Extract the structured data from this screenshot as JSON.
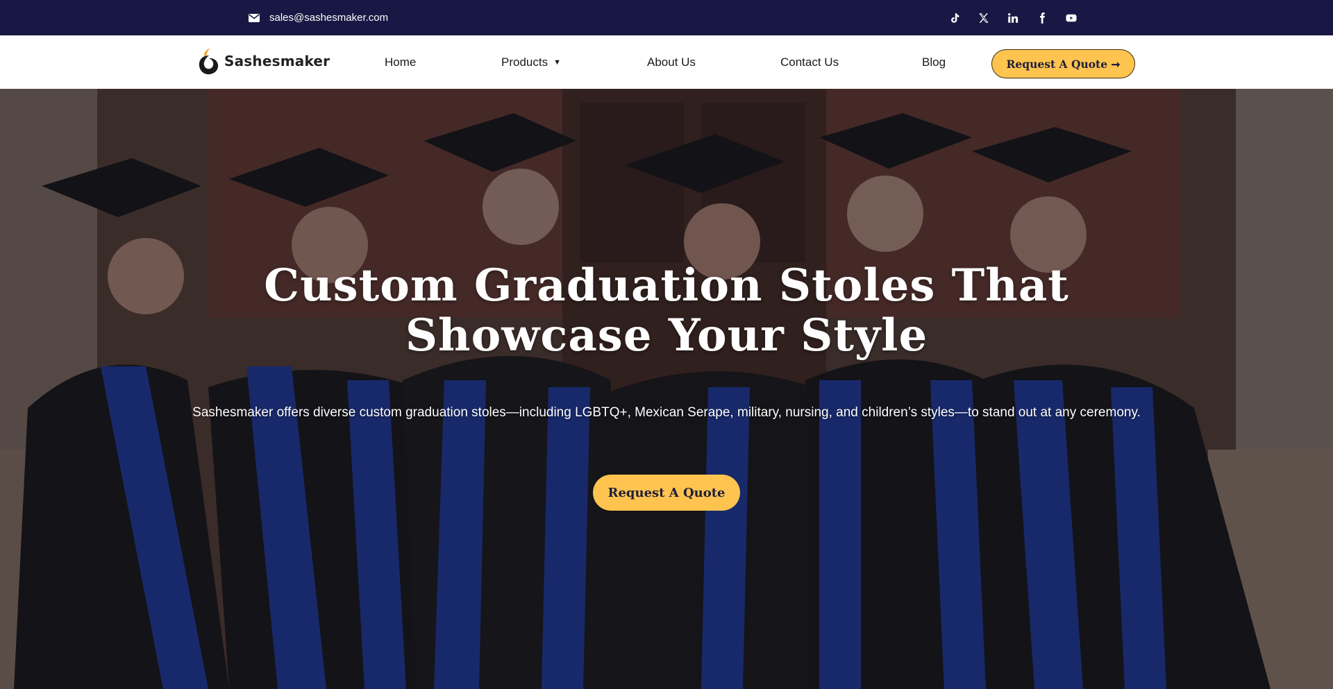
{
  "topbar": {
    "email": "sales@sashesmaker.com",
    "background": "#191844",
    "socials": [
      {
        "icon": "tiktok-icon"
      },
      {
        "icon": "x-icon"
      },
      {
        "icon": "linkedin-icon"
      },
      {
        "icon": "facebook-icon"
      },
      {
        "icon": "youtube-icon"
      }
    ]
  },
  "nav": {
    "logo_text": "Sashesmaker",
    "items": [
      {
        "label": "Home"
      },
      {
        "label": "Products"
      },
      {
        "label": "About Us"
      },
      {
        "label": "Contact Us"
      },
      {
        "label": "Blog"
      }
    ],
    "quote_button": "Request A Quote ➞"
  },
  "hero": {
    "title": "Custom Graduation Stoles That Showcase Your Style",
    "subtitle": "Sashesmaker offers diverse custom graduation stoles—including LGBTQ+, Mexican Serape, military, nursing, and children’s styles—to stand out at any ceremony.",
    "button": "Request A Quote"
  },
  "colors": {
    "accent": "#fec44f",
    "dark": "#191844",
    "stole_blue": "#1b3fb5",
    "stole_gold": "#e2b63a",
    "gown_black": "#161616"
  }
}
